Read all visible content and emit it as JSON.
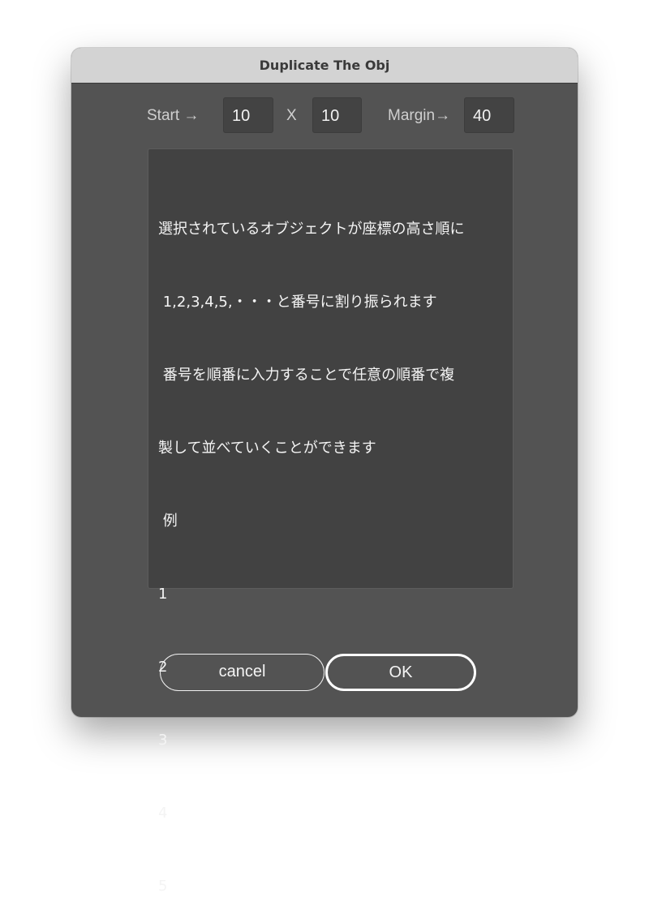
{
  "window": {
    "title": "Duplicate The Obj"
  },
  "params": {
    "start_label": "Start →",
    "start_value": "10",
    "x_label": "X",
    "x_value": "10",
    "margin_label": "Margin→",
    "margin_value": "40"
  },
  "description": {
    "lines": [
      "選択されているオブジェクトが座標の高さ順に",
      " 1,2,3,4,5,・・・と番号に割り振られます",
      " 番号を順番に入力することで任意の順番で複",
      "製して並べていくことができます",
      " 例",
      "1",
      "2",
      "3",
      "4",
      "5"
    ]
  },
  "buttons": {
    "cancel_label": "cancel",
    "ok_label": "OK"
  }
}
